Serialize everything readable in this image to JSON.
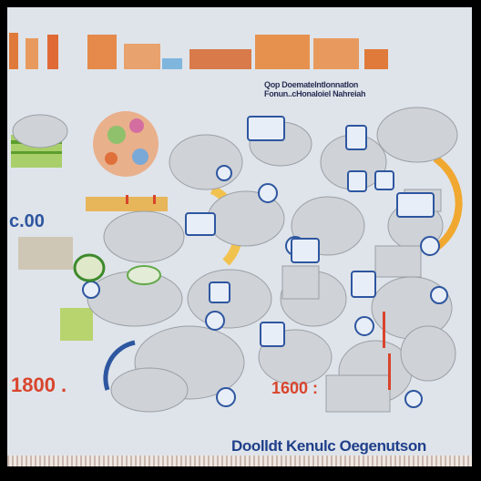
{
  "header_small_text": [
    "Qop DoemateIntlonnatIon",
    "Fonun..cHonaloiel Nahreiah"
  ],
  "left_label": "c.00",
  "left_number": "1800 .",
  "middle_number": "1600 :",
  "footer_title": "Doolldt Kenulc Oegenutson",
  "colors": {
    "background": "#dfe4ea",
    "accent_orange": "#e07a3a",
    "accent_blue": "#2e56a0",
    "accent_red": "#d9442c",
    "accent_green": "#7bbf45"
  }
}
